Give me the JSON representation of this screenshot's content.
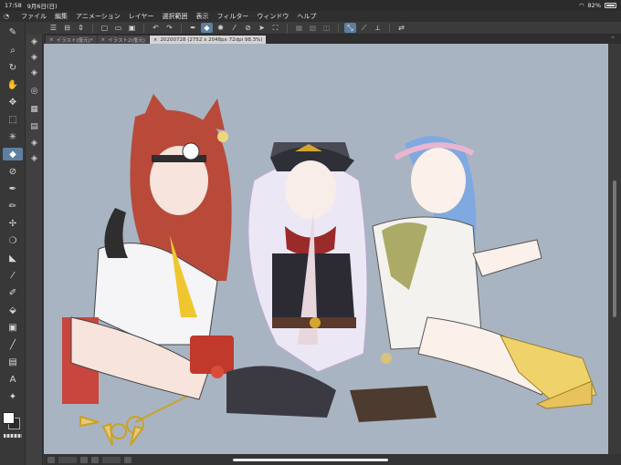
{
  "status": {
    "time": "17:58",
    "date": "9月6日(日)",
    "battery": "82%",
    "battery_level": 0.82
  },
  "menu": {
    "items": [
      "ファイル",
      "編集",
      "アニメーション",
      "レイヤー",
      "選択範囲",
      "表示",
      "フィルター",
      "ウィンドウ",
      "ヘルプ"
    ]
  },
  "tabs": [
    {
      "label": "イラスト(復元)*",
      "active": false
    },
    {
      "label": "イラスト2(復元)",
      "active": false
    },
    {
      "label": "20200728 (2752 x 2048px 72dpi 98.3%)",
      "active": true
    }
  ],
  "colors": {
    "canvas_bg": "#a9b4c2",
    "accent": "#5e7fa0",
    "ui_dark": "#3a3a3a",
    "main_color": "#ffffff",
    "sub_color": "#2a2a2a"
  },
  "icons": {
    "toolbar": [
      "menu-icon",
      "adjust-icon",
      "stepper-icon",
      "new-file-icon",
      "open-icon",
      "save-icon",
      "undo-icon",
      "redo-icon",
      "pen-icon",
      "eraser-icon",
      "lasso-icon",
      "eyedropper-icon",
      "fill-icon",
      "cursor-icon",
      "transform-icon",
      "ruler-icon",
      "ruler-guide-icon",
      "smooth-icon",
      "snap-icon",
      "angle-icon",
      "pen-settings-icon",
      "shortcut-icon"
    ],
    "tools": [
      "zoom-icon",
      "rotate-icon",
      "hand-icon",
      "move-icon",
      "selection-icon",
      "magic-wand-icon",
      "eraser-icon",
      "eyedropper-icon",
      "pen-icon",
      "pencil-icon",
      "airbrush-icon",
      "blend-icon",
      "smudge-icon",
      "deco-icon",
      "fill-icon",
      "gradient-icon",
      "figure-icon",
      "text-icon",
      "balloon-icon",
      "frame-icon",
      "operation-icon"
    ],
    "subtools": [
      "hard-eraser-icon",
      "soft-eraser-icon",
      "vector-eraser-icon",
      "kneaded-eraser-icon",
      "rough-eraser-icon",
      "snow-eraser-icon",
      "layer-eraser-icon",
      "tool-settings-icon"
    ]
  }
}
